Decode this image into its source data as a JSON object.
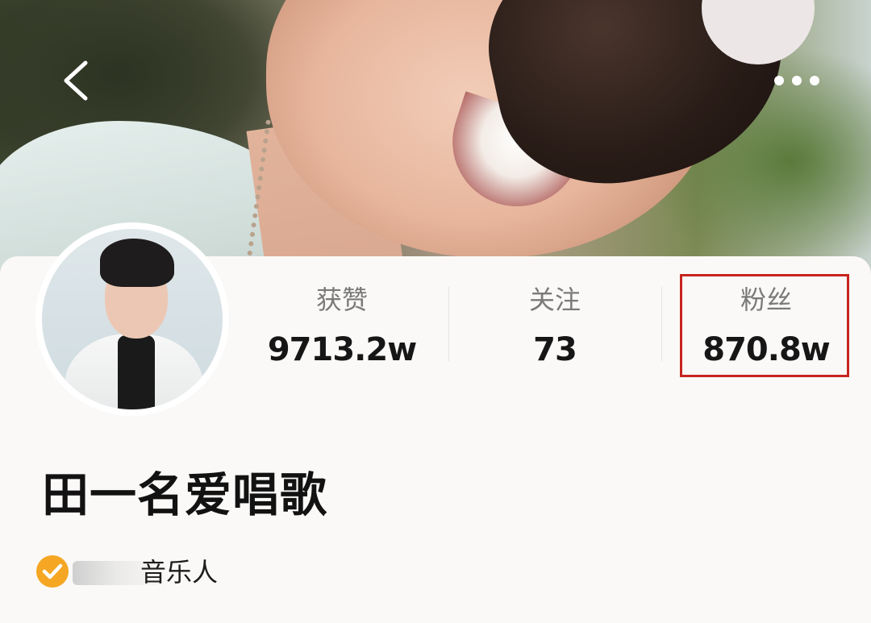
{
  "profile": {
    "name": "田一名爱唱歌",
    "verification_text": "音乐人"
  },
  "stats": {
    "likes": {
      "label": "获赞",
      "value": "9713.2w"
    },
    "following": {
      "label": "关注",
      "value": "73"
    },
    "fans": {
      "label": "粉丝",
      "value": "870.8w"
    }
  },
  "colors": {
    "highlight_border": "#c7241f",
    "verify_badge": "#f5a623",
    "background": "#fbf9f7"
  },
  "icons": {
    "back": "chevron-left-icon",
    "more": "more-dots-icon",
    "verify": "verified-check-icon"
  }
}
